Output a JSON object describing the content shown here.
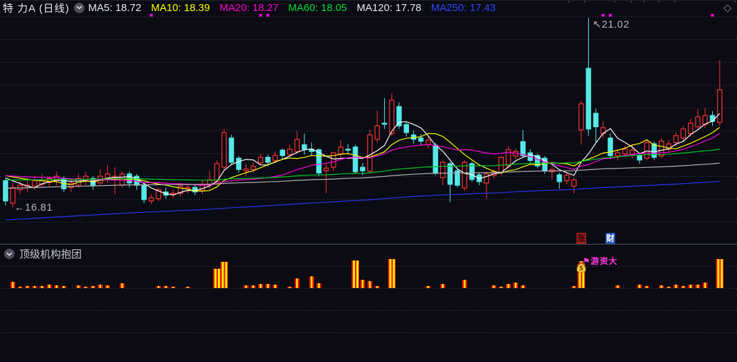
{
  "header": {
    "title": "特 力A (日线)",
    "ma_legend": [
      {
        "text": "MA5: 18.72",
        "color": "#e8e8f0"
      },
      {
        "text": "MA10: 18.39",
        "color": "#ffff00"
      },
      {
        "text": "MA20: 18.27",
        "color": "#ff00cc"
      },
      {
        "text": "MA60: 18.05",
        "color": "#00dc32"
      },
      {
        "text": "MA120: 17.78",
        "color": "#e8e8f0"
      },
      {
        "text": "MA250: 17.43",
        "color": "#2f46ff"
      }
    ],
    "corner_icon": "◇"
  },
  "sub_panel": {
    "title": "顶级机构抱团"
  },
  "chart_data": {
    "type": "candlestick",
    "symbol": "特 力A",
    "period": "日线",
    "ylim": [
      16.0,
      21.3
    ],
    "grid": "dotted-horizontal",
    "ma_series": [
      {
        "period": 5,
        "color": "#ffffff"
      },
      {
        "period": 10,
        "color": "#ffff00"
      },
      {
        "period": 20,
        "color": "#ff00e1"
      },
      {
        "period": 60,
        "color": "#00c828"
      },
      {
        "period": 120,
        "color": "#b4b4b4"
      },
      {
        "period": 250,
        "color": "#2837f0"
      }
    ],
    "annotations": {
      "low": {
        "prefix": "←",
        "text": "16.81",
        "index": 1
      },
      "high": {
        "prefix": "↖",
        "text": "21.02",
        "index": 80
      }
    },
    "badges": [
      {
        "text": "涨",
        "bg": "#a02020",
        "fg": "#2a0505",
        "index": 79
      },
      {
        "text": "财",
        "bg": "#1850b4",
        "fg": "#ffffff",
        "index": 83
      }
    ],
    "marker": {
      "flag": "⚑",
      "text": "游资大",
      "icon": "money-bag-icon",
      "index": 79
    },
    "top_dot_indices": [
      20,
      35,
      36,
      82,
      83,
      97
    ],
    "candles": [
      [
        17.4,
        17.45,
        16.85,
        16.95
      ],
      [
        16.9,
        17.35,
        16.81,
        17.25
      ],
      [
        17.2,
        17.4,
        17.1,
        17.3
      ],
      [
        17.25,
        17.45,
        17.15,
        17.3
      ],
      [
        17.28,
        17.5,
        17.2,
        17.4
      ],
      [
        17.32,
        17.55,
        17.25,
        17.42
      ],
      [
        17.36,
        17.5,
        17.25,
        17.45
      ],
      [
        17.4,
        17.6,
        17.3,
        17.5
      ],
      [
        17.45,
        17.5,
        17.15,
        17.22
      ],
      [
        17.25,
        17.45,
        17.15,
        17.35
      ],
      [
        17.3,
        17.55,
        17.25,
        17.45
      ],
      [
        17.4,
        17.6,
        17.3,
        17.5
      ],
      [
        17.45,
        17.5,
        17.2,
        17.3
      ],
      [
        17.35,
        17.65,
        17.3,
        17.5
      ],
      [
        17.45,
        17.75,
        17.35,
        17.55
      ],
      [
        17.5,
        17.7,
        17.1,
        17.5
      ],
      [
        17.3,
        17.6,
        17.25,
        17.55
      ],
      [
        17.55,
        17.6,
        17.25,
        17.35
      ],
      [
        17.5,
        17.55,
        17.2,
        17.3
      ],
      [
        17.3,
        17.35,
        16.9,
        16.98
      ],
      [
        16.95,
        17.1,
        16.88,
        17.02
      ],
      [
        17.0,
        17.25,
        16.95,
        17.2
      ],
      [
        17.15,
        17.25,
        17.0,
        17.08
      ],
      [
        17.1,
        17.2,
        17.02,
        17.12
      ],
      [
        17.12,
        17.35,
        17.05,
        17.28
      ],
      [
        17.22,
        17.32,
        17.12,
        17.25
      ],
      [
        17.25,
        17.3,
        17.08,
        17.15
      ],
      [
        17.18,
        17.4,
        17.1,
        17.32
      ],
      [
        17.3,
        17.62,
        17.22,
        17.42
      ],
      [
        17.38,
        17.85,
        17.3,
        17.78
      ],
      [
        17.7,
        18.55,
        17.62,
        18.47
      ],
      [
        18.35,
        18.42,
        17.75,
        17.81
      ],
      [
        17.9,
        17.95,
        17.58,
        17.65
      ],
      [
        17.62,
        17.78,
        17.5,
        17.66
      ],
      [
        17.65,
        17.82,
        17.58,
        17.72
      ],
      [
        17.8,
        18.0,
        17.75,
        17.92
      ],
      [
        17.92,
        17.98,
        17.72,
        17.81
      ],
      [
        17.85,
        18.05,
        17.78,
        17.96
      ],
      [
        18.08,
        18.12,
        17.88,
        17.96
      ],
      [
        17.98,
        18.2,
        17.92,
        18.1
      ],
      [
        18.05,
        18.5,
        18.0,
        18.32
      ],
      [
        18.2,
        18.45,
        17.98,
        18.1
      ],
      [
        18.1,
        18.25,
        17.95,
        18.05
      ],
      [
        18.09,
        18.12,
        17.5,
        17.57
      ],
      [
        17.62,
        17.75,
        17.12,
        17.68
      ],
      [
        17.7,
        18.05,
        17.62,
        18.02
      ],
      [
        18.0,
        18.3,
        17.92,
        18.15
      ],
      [
        18.1,
        18.22,
        17.98,
        18.08
      ],
      [
        18.15,
        18.2,
        17.55,
        17.6
      ],
      [
        17.7,
        17.8,
        17.52,
        17.62
      ],
      [
        17.61,
        18.53,
        17.58,
        18.42
      ],
      [
        18.32,
        18.96,
        18.25,
        18.62
      ],
      [
        18.68,
        19.24,
        18.55,
        18.66
      ],
      [
        18.45,
        19.35,
        18.4,
        19.19
      ],
      [
        19.05,
        19.14,
        18.55,
        18.62
      ],
      [
        18.65,
        18.72,
        18.38,
        18.47
      ],
      [
        18.42,
        18.52,
        18.22,
        18.32
      ],
      [
        18.35,
        18.44,
        18.18,
        18.28
      ],
      [
        18.2,
        18.4,
        18.12,
        18.3
      ],
      [
        18.19,
        18.24,
        17.52,
        17.58
      ],
      [
        17.47,
        17.85,
        17.3,
        17.81
      ],
      [
        17.78,
        17.82,
        16.92,
        17.32
      ],
      [
        17.62,
        17.68,
        17.25,
        17.3
      ],
      [
        17.24,
        17.85,
        17.18,
        17.81
      ],
      [
        17.78,
        17.82,
        17.38,
        17.43
      ],
      [
        17.53,
        17.58,
        17.3,
        17.38
      ],
      [
        17.35,
        17.6,
        17.0,
        17.55
      ],
      [
        17.52,
        17.65,
        17.45,
        17.6
      ],
      [
        17.58,
        17.95,
        17.52,
        17.92
      ],
      [
        17.73,
        18.17,
        17.68,
        18.09
      ],
      [
        17.95,
        18.12,
        17.88,
        18.05
      ],
      [
        18.27,
        18.53,
        17.92,
        17.96
      ],
      [
        18.02,
        18.1,
        17.8,
        17.85
      ],
      [
        17.96,
        18.0,
        17.68,
        17.73
      ],
      [
        17.9,
        17.95,
        17.55,
        17.62
      ],
      [
        17.6,
        17.72,
        17.42,
        17.65
      ],
      [
        17.53,
        17.58,
        17.22,
        17.38
      ],
      [
        17.4,
        17.58,
        17.32,
        17.52
      ],
      [
        17.28,
        17.48,
        17.12,
        17.42
      ],
      [
        18.53,
        19.18,
        18.2,
        19.11
      ],
      [
        19.9,
        21.02,
        18.4,
        18.55
      ],
      [
        18.9,
        19.0,
        18.25,
        18.6
      ],
      [
        18.45,
        18.72,
        18.35,
        18.58
      ],
      [
        18.35,
        18.45,
        17.88,
        17.96
      ],
      [
        17.95,
        18.1,
        17.85,
        18.02
      ],
      [
        18.0,
        18.18,
        17.95,
        18.1
      ],
      [
        17.98,
        18.22,
        17.9,
        18.08
      ],
      [
        17.96,
        18.02,
        17.78,
        17.86
      ],
      [
        17.9,
        18.32,
        17.85,
        18.25
      ],
      [
        18.22,
        18.27,
        17.86,
        17.92
      ],
      [
        17.95,
        18.35,
        17.9,
        18.28
      ],
      [
        18.1,
        18.3,
        18.02,
        18.22
      ],
      [
        18.25,
        18.48,
        18.16,
        18.4
      ],
      [
        18.35,
        18.62,
        18.28,
        18.55
      ],
      [
        18.45,
        18.78,
        18.38,
        18.68
      ],
      [
        18.6,
        19.0,
        18.52,
        18.82
      ],
      [
        18.65,
        19.02,
        18.58,
        18.85
      ],
      [
        18.85,
        18.95,
        18.62,
        18.72
      ],
      [
        18.7,
        20.08,
        18.62,
        19.42
      ]
    ],
    "inst_bars": {
      "1": 9,
      "2": 2,
      "3": 3,
      "4": 3,
      "5": 3,
      "6": 5,
      "7": 4,
      "8": 3,
      "10": 4,
      "11": 2,
      "12": 3,
      "13": 5,
      "14": 4,
      "16": 7,
      "21": 3,
      "22": 3,
      "23": 2,
      "25": 2,
      "29": 28,
      "30": 38,
      "33": 4,
      "34": 4,
      "35": 6,
      "36": 6,
      "37": 5,
      "39": 2,
      "40": 14,
      "42": 17,
      "43": 7,
      "48": 40,
      "49": 12,
      "50": 10,
      "51": 3,
      "53": 42,
      "58": 3,
      "60": 6,
      "63": 12,
      "67": 4,
      "68": 2,
      "69": 6,
      "70": 8,
      "71": 4,
      "78": 3,
      "79": 35,
      "84": 4,
      "87": 5,
      "88": 3,
      "90": 4,
      "91": 2,
      "92": 5,
      "93": 3,
      "94": 5,
      "95": 5,
      "96": 8,
      "98": 42
    },
    "colors": {
      "up": "#ff3434",
      "down": "#54e8e8",
      "bar_red": "#e81010",
      "bar_yellow": "#ffee00",
      "grid": "#4c4c58",
      "background": "#0a0b13",
      "dot": "#ff00e1"
    }
  }
}
